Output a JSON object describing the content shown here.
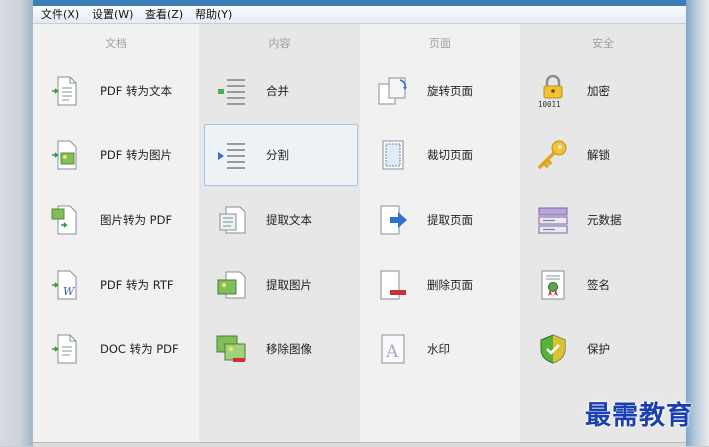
{
  "menubar": {
    "file": "文件(X)",
    "settings": "设置(W)",
    "view": "查看(Z)",
    "help": "帮助(Y)"
  },
  "columns": {
    "document": {
      "header": "文档",
      "items": [
        "PDF 转为文本",
        "PDF 转为图片",
        "图片转为 PDF",
        "PDF 转为 RTF",
        "DOC 转为 PDF"
      ],
      "icons": [
        "pdf-to-text-icon",
        "pdf-to-image-icon",
        "image-to-pdf-icon",
        "pdf-to-rtf-icon",
        "doc-to-pdf-icon"
      ]
    },
    "content": {
      "header": "内容",
      "items": [
        "合并",
        "分割",
        "提取文本",
        "提取图片",
        "移除图像"
      ],
      "icons": [
        "merge-icon",
        "split-icon",
        "extract-text-icon",
        "extract-image-icon",
        "remove-image-icon"
      ]
    },
    "page": {
      "header": "页面",
      "items": [
        "旋转页面",
        "裁切页面",
        "提取页面",
        "删除页面",
        "水印"
      ],
      "icons": [
        "rotate-page-icon",
        "crop-page-icon",
        "extract-page-icon",
        "delete-page-icon",
        "watermark-icon"
      ]
    },
    "security": {
      "header": "安全",
      "items": [
        "加密",
        "解锁",
        "元数据",
        "签名",
        "保护"
      ],
      "icons": [
        "lock-icon",
        "key-icon",
        "metadata-icon",
        "certificate-icon",
        "shield-icon"
      ]
    }
  },
  "selected_item": "分割",
  "watermark_text": "最需教育",
  "colors": {
    "frame_blue": "#3f7fb8",
    "selection_border": "#a9c3de",
    "watermark": "#1a3fb0"
  }
}
